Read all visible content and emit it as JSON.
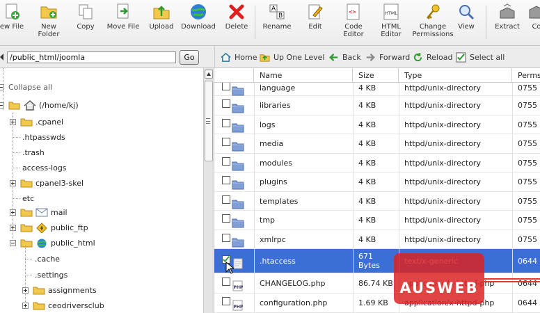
{
  "toolbar": {
    "buttons": [
      {
        "id": "new-file",
        "label": "ew File",
        "icon": "new-file-icon"
      },
      {
        "id": "new-folder",
        "label": "New\nFolder",
        "icon": "new-folder-icon"
      },
      {
        "id": "copy",
        "label": "Copy",
        "icon": "copy-icon"
      },
      {
        "id": "move-file",
        "label": "Move File",
        "icon": "move-file-icon"
      },
      {
        "id": "upload",
        "label": "Upload",
        "icon": "upload-icon"
      },
      {
        "id": "download",
        "label": "Download",
        "icon": "download-icon"
      },
      {
        "id": "delete",
        "label": "Delete",
        "icon": "delete-icon"
      },
      {
        "id": "rename",
        "label": "Rename",
        "icon": "rename-icon"
      },
      {
        "id": "edit",
        "label": "Edit",
        "icon": "edit-icon"
      },
      {
        "id": "code-editor",
        "label": "Code\nEditor",
        "icon": "code-editor-icon"
      },
      {
        "id": "html-editor",
        "label": "HTML\nEditor",
        "icon": "html-editor-icon"
      },
      {
        "id": "change-permissions",
        "label": "Change\nPermissions",
        "icon": "key-icon"
      },
      {
        "id": "view",
        "label": "View",
        "icon": "magnifier-icon"
      },
      {
        "id": "extract",
        "label": "Extract",
        "icon": "extract-icon"
      },
      {
        "id": "compress",
        "label": "Co",
        "icon": "compress-icon"
      }
    ]
  },
  "pathbar": {
    "path_value": "/public_html/joomla",
    "go_label": "Go"
  },
  "navbar": {
    "home": "Home",
    "up_one_level": "Up One Level",
    "back": "Back",
    "forward": "Forward",
    "reload": "Reload",
    "select_all": "Select all"
  },
  "tree": {
    "collapse_all": "Collapse all",
    "root": "(/home/kj)",
    "items": [
      {
        "label": ".cpanel",
        "type": "folder",
        "expander": "plus"
      },
      {
        "label": ".htpasswds",
        "type": "leaf"
      },
      {
        "label": ".trash",
        "type": "leaf"
      },
      {
        "label": "access-logs",
        "type": "leaf"
      },
      {
        "label": "cpanel3-skel",
        "type": "folder",
        "expander": "plus"
      },
      {
        "label": "etc",
        "type": "leaf"
      },
      {
        "label": "mail",
        "type": "mail",
        "expander": "plus"
      },
      {
        "label": "public_ftp",
        "type": "ftp",
        "expander": "plus"
      },
      {
        "label": "public_html",
        "type": "globe",
        "expander": "minus"
      },
      {
        "label": ".cache",
        "type": "leaf"
      },
      {
        "label": ".settings",
        "type": "leaf"
      },
      {
        "label": "assignments",
        "type": "folder",
        "expander": "plus"
      },
      {
        "label": "ceodriversclub",
        "type": "folder",
        "expander": "plus"
      }
    ]
  },
  "files": {
    "columns": [
      "Name",
      "Size",
      "Type",
      "Perms"
    ],
    "rows": [
      {
        "name": "language",
        "size": "4 KB",
        "type": "httpd/unix-directory",
        "perms": "0755",
        "icon": "folder-icon",
        "checked": false
      },
      {
        "name": "libraries",
        "size": "4 KB",
        "type": "httpd/unix-directory",
        "perms": "0755",
        "icon": "folder-icon",
        "checked": false
      },
      {
        "name": "logs",
        "size": "4 KB",
        "type": "httpd/unix-directory",
        "perms": "0755",
        "icon": "folder-icon",
        "checked": false
      },
      {
        "name": "media",
        "size": "4 KB",
        "type": "httpd/unix-directory",
        "perms": "0755",
        "icon": "folder-icon",
        "checked": false
      },
      {
        "name": "modules",
        "size": "4 KB",
        "type": "httpd/unix-directory",
        "perms": "0755",
        "icon": "folder-icon",
        "checked": false
      },
      {
        "name": "plugins",
        "size": "4 KB",
        "type": "httpd/unix-directory",
        "perms": "0755",
        "icon": "folder-icon",
        "checked": false
      },
      {
        "name": "templates",
        "size": "4 KB",
        "type": "httpd/unix-directory",
        "perms": "0755",
        "icon": "folder-icon",
        "checked": false
      },
      {
        "name": "tmp",
        "size": "4 KB",
        "type": "httpd/unix-directory",
        "perms": "0755",
        "icon": "folder-icon",
        "checked": false
      },
      {
        "name": "xmlrpc",
        "size": "4 KB",
        "type": "httpd/unix-directory",
        "perms": "0755",
        "icon": "folder-icon",
        "checked": false
      },
      {
        "name": ".htaccess",
        "size": "671\nBytes",
        "type": "text/x-generic",
        "perms": "0644",
        "icon": "text-file-icon",
        "checked": true,
        "selected": true
      },
      {
        "name": "CHANGELOG.php",
        "size": "86.74 KB",
        "type": "application/x-httpd-php",
        "perms": "0644",
        "icon": "php-icon",
        "checked": false
      },
      {
        "name": "configuration.php",
        "size": "1.69 KB",
        "type": "application/x-httpd-php",
        "perms": "0644",
        "icon": "php-icon",
        "checked": false
      }
    ]
  },
  "watermark": {
    "text": "AUSWEB"
  },
  "colors": {
    "selection": "#3b6fd6",
    "watermark": "#dc2323",
    "folder": "#5b7fc7",
    "toolbar_bg": "#f1f1f1"
  }
}
